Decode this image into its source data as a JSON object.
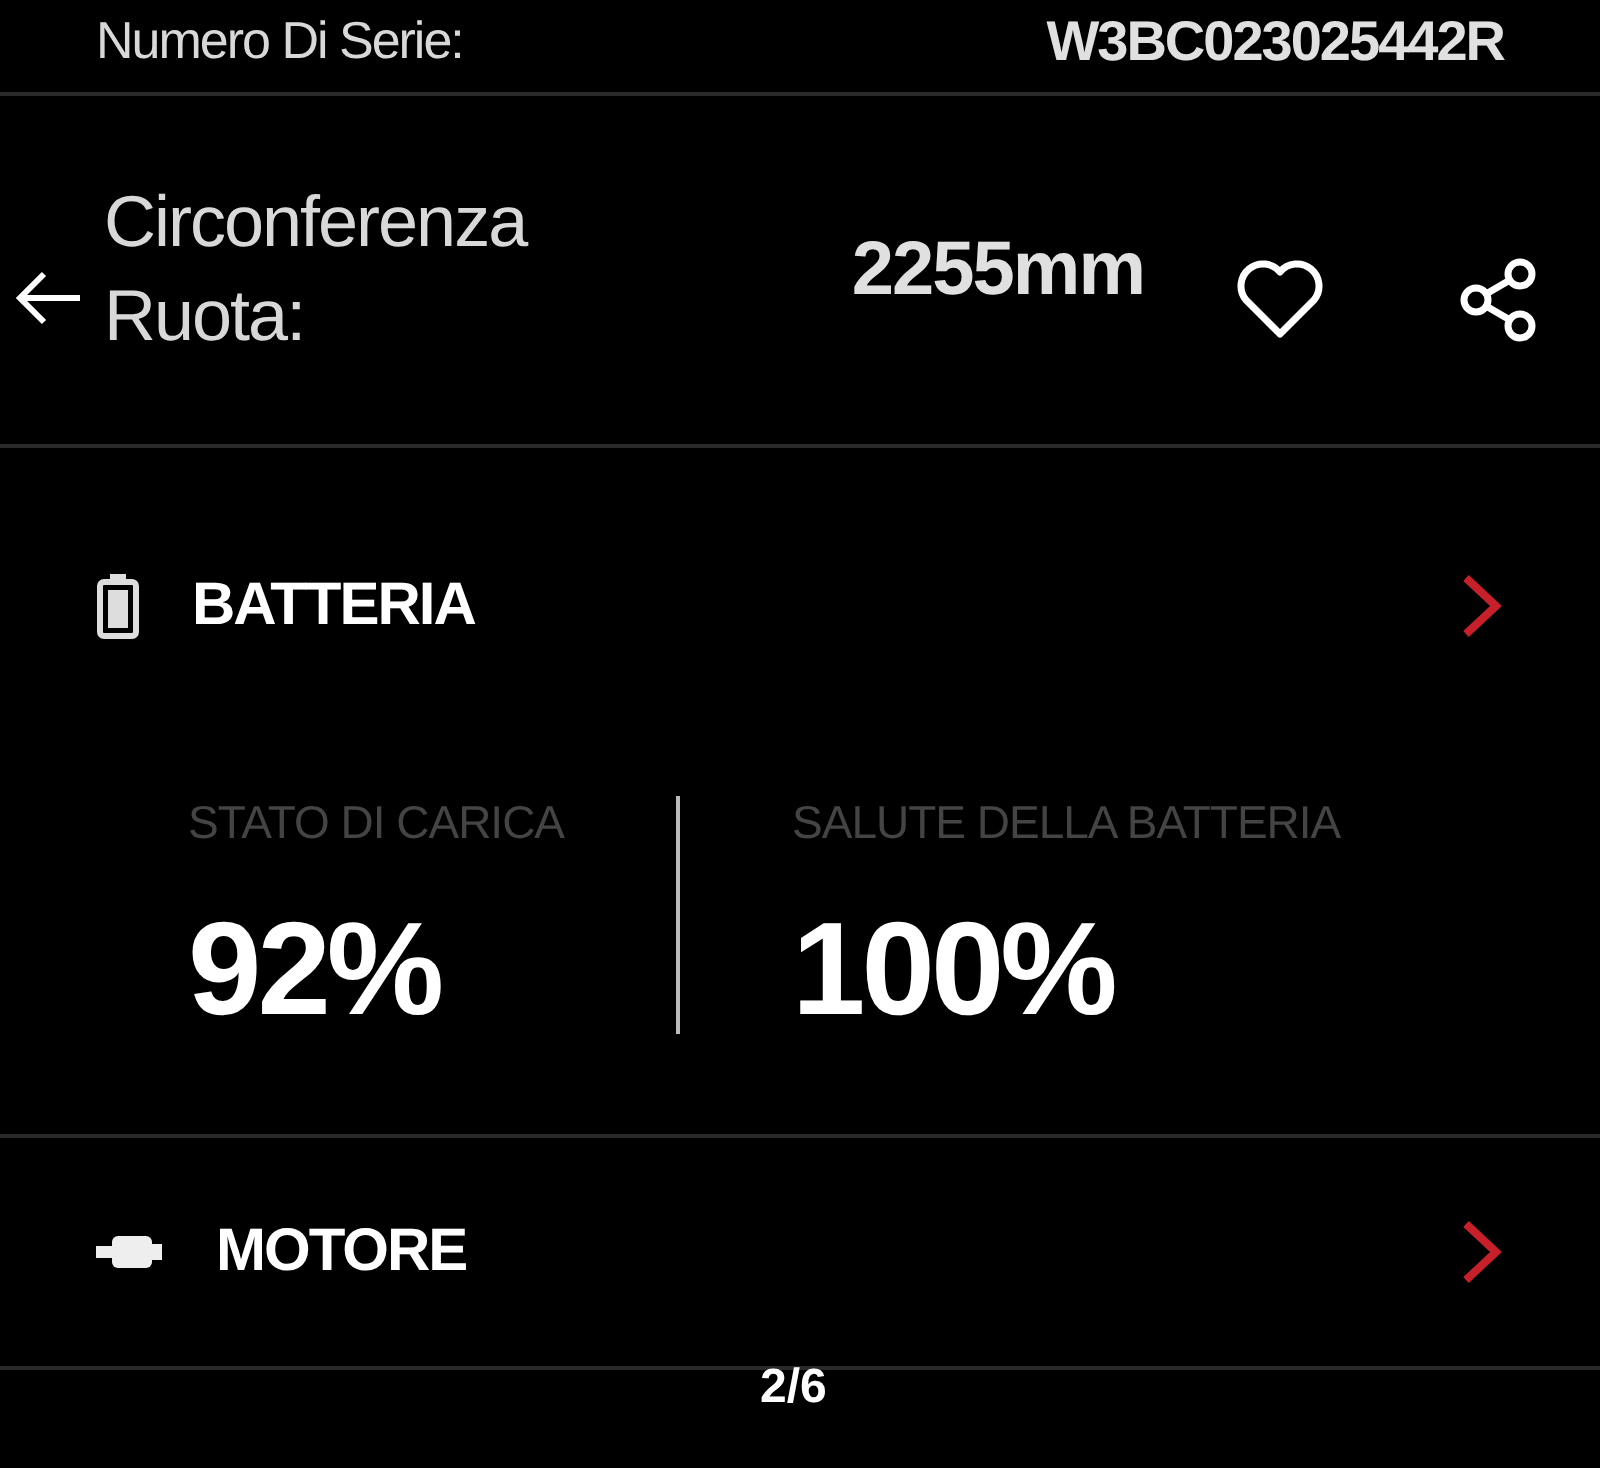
{
  "details": [
    {
      "label": "Numero Di Serie:",
      "value": "W3BC023025442R"
    },
    {
      "label": "Circonferenza Ruota:",
      "value": "2255mm"
    }
  ],
  "sections": [
    {
      "kind": "battery",
      "title": "BATTERIA",
      "stats": [
        {
          "label": "STATO DI CARICA",
          "value": "92%"
        },
        {
          "label": "SALUTE DELLA BATTERIA",
          "value": "100%"
        }
      ]
    },
    {
      "kind": "motor",
      "title": "MOTORE"
    }
  ],
  "viewer": {
    "counter": "2/6"
  }
}
